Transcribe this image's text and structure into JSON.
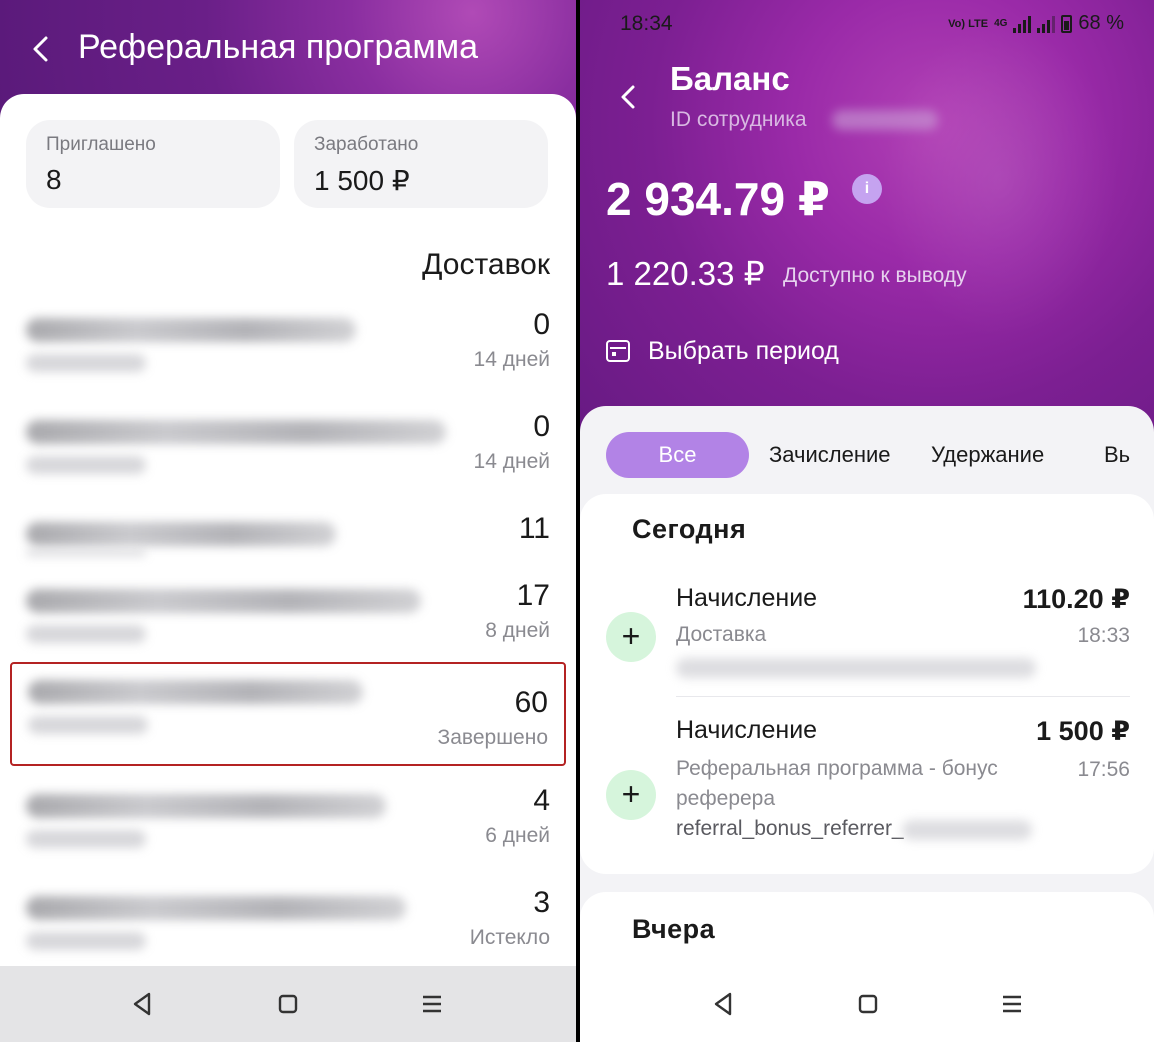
{
  "left": {
    "title": "Реферальная программа",
    "stats": {
      "invited_label": "Приглашено",
      "invited_value": "8",
      "earned_label": "Заработано",
      "earned_value": "1 500 ₽"
    },
    "column_header": "Доставок",
    "referrals": [
      {
        "count": "0",
        "status": "14 дней"
      },
      {
        "count": "0",
        "status": "14 дней"
      },
      {
        "count": "11",
        "status": ""
      },
      {
        "count": "17",
        "status": "8 дней"
      },
      {
        "count": "60",
        "status": "Завершено",
        "highlighted": true
      },
      {
        "count": "4",
        "status": "6 дней"
      },
      {
        "count": "3",
        "status": "Истекло"
      }
    ]
  },
  "right": {
    "status_bar": {
      "time": "18:34",
      "network": "Vo) LTE",
      "network_type": "4G",
      "battery": "68 %"
    },
    "title": "Баланс",
    "employee_label": "ID сотрудника",
    "balance": "2 934.79 ₽",
    "available_amount": "1 220.33 ₽",
    "available_label": "Доступно к выводу",
    "period_button": "Выбрать период",
    "tabs": [
      "Все",
      "Зачисление",
      "Удержание",
      "Вь"
    ],
    "active_tab_index": 0,
    "sections": [
      {
        "title": "Сегодня",
        "transactions": [
          {
            "type": "Начисление",
            "amount": "110.20 ₽",
            "desc": "Доставка",
            "time": "18:33"
          },
          {
            "type": "Начисление",
            "amount": "1 500 ₽",
            "desc": "Реферальная программа - бонус реферера",
            "desc2": "referral_bonus_referrer_",
            "time": "17:56"
          }
        ]
      },
      {
        "title": "Вчера",
        "transactions": []
      }
    ]
  },
  "colors": {
    "purple_header": "#7c1f92",
    "accent_tab": "#b283e6",
    "plus_bg": "#d6f5dc",
    "highlight_border": "#b42323"
  }
}
